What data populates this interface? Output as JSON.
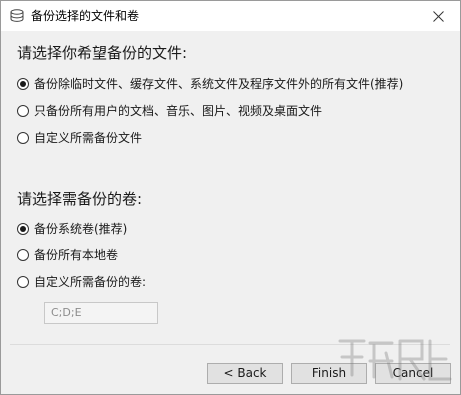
{
  "window": {
    "title": "备份选择的文件和卷",
    "title_icon": "disk-drive-icon",
    "close_icon": "close-icon"
  },
  "files_section": {
    "heading": "请选择你希望备份的文件:",
    "options": [
      {
        "label": "备份除临时文件、缓存文件、系统文件及程序文件外的所有文件(推荐)",
        "checked": true
      },
      {
        "label": "只备份所有用户的文档、音乐、图片、视频及桌面文件",
        "checked": false
      },
      {
        "label": "自定义所需备份文件",
        "checked": false
      }
    ]
  },
  "volumes_section": {
    "heading": "请选择需备份的卷:",
    "options": [
      {
        "label": "备份系统卷(推荐)",
        "checked": true
      },
      {
        "label": "备份所有本地卷",
        "checked": false
      },
      {
        "label": "自定义所需备份的卷:",
        "checked": false
      }
    ],
    "custom_volumes_value": "C;D;E"
  },
  "buttons": {
    "back": "< Back",
    "finish": "Finish",
    "cancel": "Cancel"
  },
  "colors": {
    "window_bg": "#f0f0f0",
    "titlebar_bg": "#ffffff",
    "button_bg": "#e1e1e1",
    "disabled_text": "#8c8c8c"
  }
}
